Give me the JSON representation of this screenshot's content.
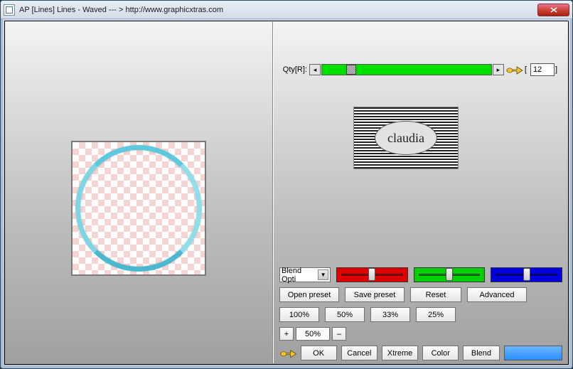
{
  "window": {
    "title": "AP [Lines]  Lines - Waved   --- >  http://www.graphicxtras.com"
  },
  "qty": {
    "label": "Qty[R]:",
    "value": "12"
  },
  "logo": {
    "text": "claudia"
  },
  "blend": {
    "select_label": "Blend Opti",
    "sliders": {
      "red": 50,
      "green": 50,
      "blue": 50
    }
  },
  "preset_row": {
    "open": "Open preset",
    "save": "Save preset",
    "reset": "Reset",
    "advanced": "Advanced"
  },
  "percent_row": {
    "p100": "100%",
    "p50": "50%",
    "p33": "33%",
    "p25": "25%"
  },
  "step": {
    "plus": "+",
    "value": "50%",
    "minus": "–"
  },
  "bottom": {
    "ok": "OK",
    "cancel": "Cancel",
    "xtreme": "Xtreme",
    "color": "Color",
    "blend": "Blend"
  },
  "colors": {
    "swatch": "#3d99ff"
  }
}
